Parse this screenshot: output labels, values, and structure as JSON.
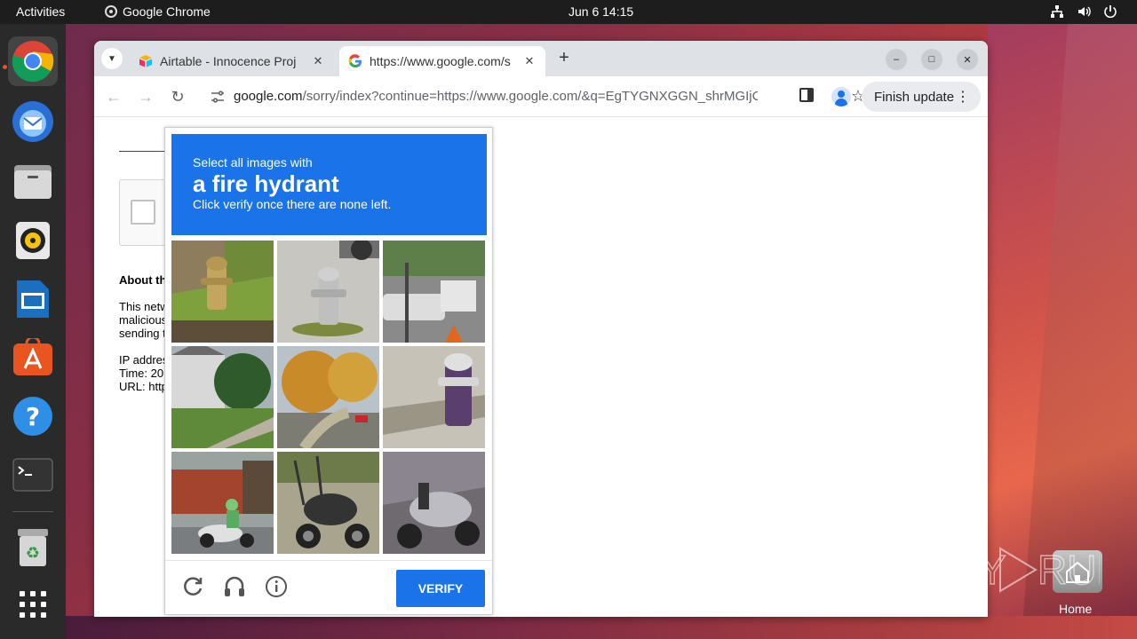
{
  "topbar": {
    "activities": "Activities",
    "app_name": "Google Chrome",
    "clock": "Jun 6  14:15",
    "tray_icons": [
      "network-icon",
      "volume-icon",
      "power-icon"
    ]
  },
  "dock": {
    "items": [
      "chrome",
      "thunderbird",
      "files",
      "rhythmbox",
      "libreoffice-impress",
      "app-center",
      "help",
      "terminal",
      "trash",
      "show-apps"
    ]
  },
  "browser": {
    "tabs": [
      {
        "title": "Airtable - Innocence Proj",
        "active": false
      },
      {
        "title": "https://www.google.com/s",
        "active": true
      }
    ],
    "url_domain": "google.com",
    "url_rest": "/sorry/index?continue=https://www.google.com/&q=EgTYGNXGGN_shrMGIjCZl...",
    "finish_update": "Finish update"
  },
  "page": {
    "about_heading": "About th",
    "para_lines": [
      "This netw",
      "malicious",
      "sending t"
    ],
    "ip_line": "IP addres",
    "time_line": "Time: 20",
    "url_line": "URL: http"
  },
  "captcha": {
    "instruction_line1": "Select all images with",
    "target": "a fire hydrant",
    "instruction_line3": "Click verify once there are none left.",
    "verify_label": "VERIFY",
    "colors": {
      "header": "#1a73e8",
      "button": "#1a73e8"
    }
  },
  "desktop": {
    "home_label": "Home",
    "watermark": "ANY RUN"
  }
}
